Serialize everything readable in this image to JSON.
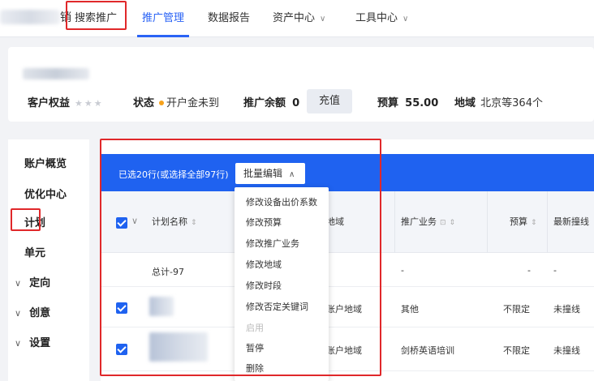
{
  "topbar": {
    "brand": "销",
    "nav": [
      {
        "label": "搜索推广",
        "active": false
      },
      {
        "label": "推广管理",
        "active": true
      },
      {
        "label": "数据报告",
        "active": false
      },
      {
        "label": "资产中心",
        "active": false
      },
      {
        "label": "工具中心",
        "active": false
      }
    ]
  },
  "account": {
    "rights_label": "客户权益",
    "rights_stars": "★★★",
    "status_label": "状态",
    "status_value": "开户金未到",
    "balance_label": "推广余额",
    "balance_value": "0",
    "recharge_label": "充值",
    "budget_label": "预算",
    "budget_value": "55.00",
    "region_label": "地域",
    "region_value": "北京等364个"
  },
  "sidebar": {
    "items": [
      {
        "label": "账户概览"
      },
      {
        "label": "优化中心"
      },
      {
        "label": "计划"
      },
      {
        "label": "单元"
      },
      {
        "label": "定向"
      },
      {
        "label": "创意"
      },
      {
        "label": "设置"
      }
    ]
  },
  "toolbar": {
    "selection_text": "已选20行(或选择全部97行)",
    "batch_edit_label": "批量编辑"
  },
  "table": {
    "headers": {
      "name": "计划名称",
      "region": "地域",
      "business": "推广业务",
      "budget": "预算",
      "latest": "最新撞线"
    },
    "total_row": {
      "name": "总计-97",
      "business": "-",
      "budget": "-",
      "latest": "-"
    },
    "rows": [
      {
        "region": "账户地域",
        "business": "其他",
        "budget": "不限定",
        "latest": "未撞线"
      },
      {
        "region": "账户地域",
        "business": "剑桥英语培训",
        "budget": "不限定",
        "latest": "未撞线"
      }
    ]
  },
  "dropdown": {
    "items": [
      {
        "label": "修改设备出价系数",
        "disabled": false
      },
      {
        "label": "修改预算",
        "disabled": false
      },
      {
        "label": "修改推广业务",
        "disabled": false
      },
      {
        "label": "修改地域",
        "disabled": false
      },
      {
        "label": "修改时段",
        "disabled": false
      },
      {
        "label": "修改否定关键词",
        "disabled": false
      },
      {
        "label": "启用",
        "disabled": true
      },
      {
        "label": "暂停",
        "disabled": false
      },
      {
        "label": "删除",
        "disabled": false
      }
    ]
  },
  "colors": {
    "accent": "#2a63f5",
    "bar": "#1f62f0",
    "highlight": "#e0282a",
    "status_dot": "#f7a21b"
  }
}
